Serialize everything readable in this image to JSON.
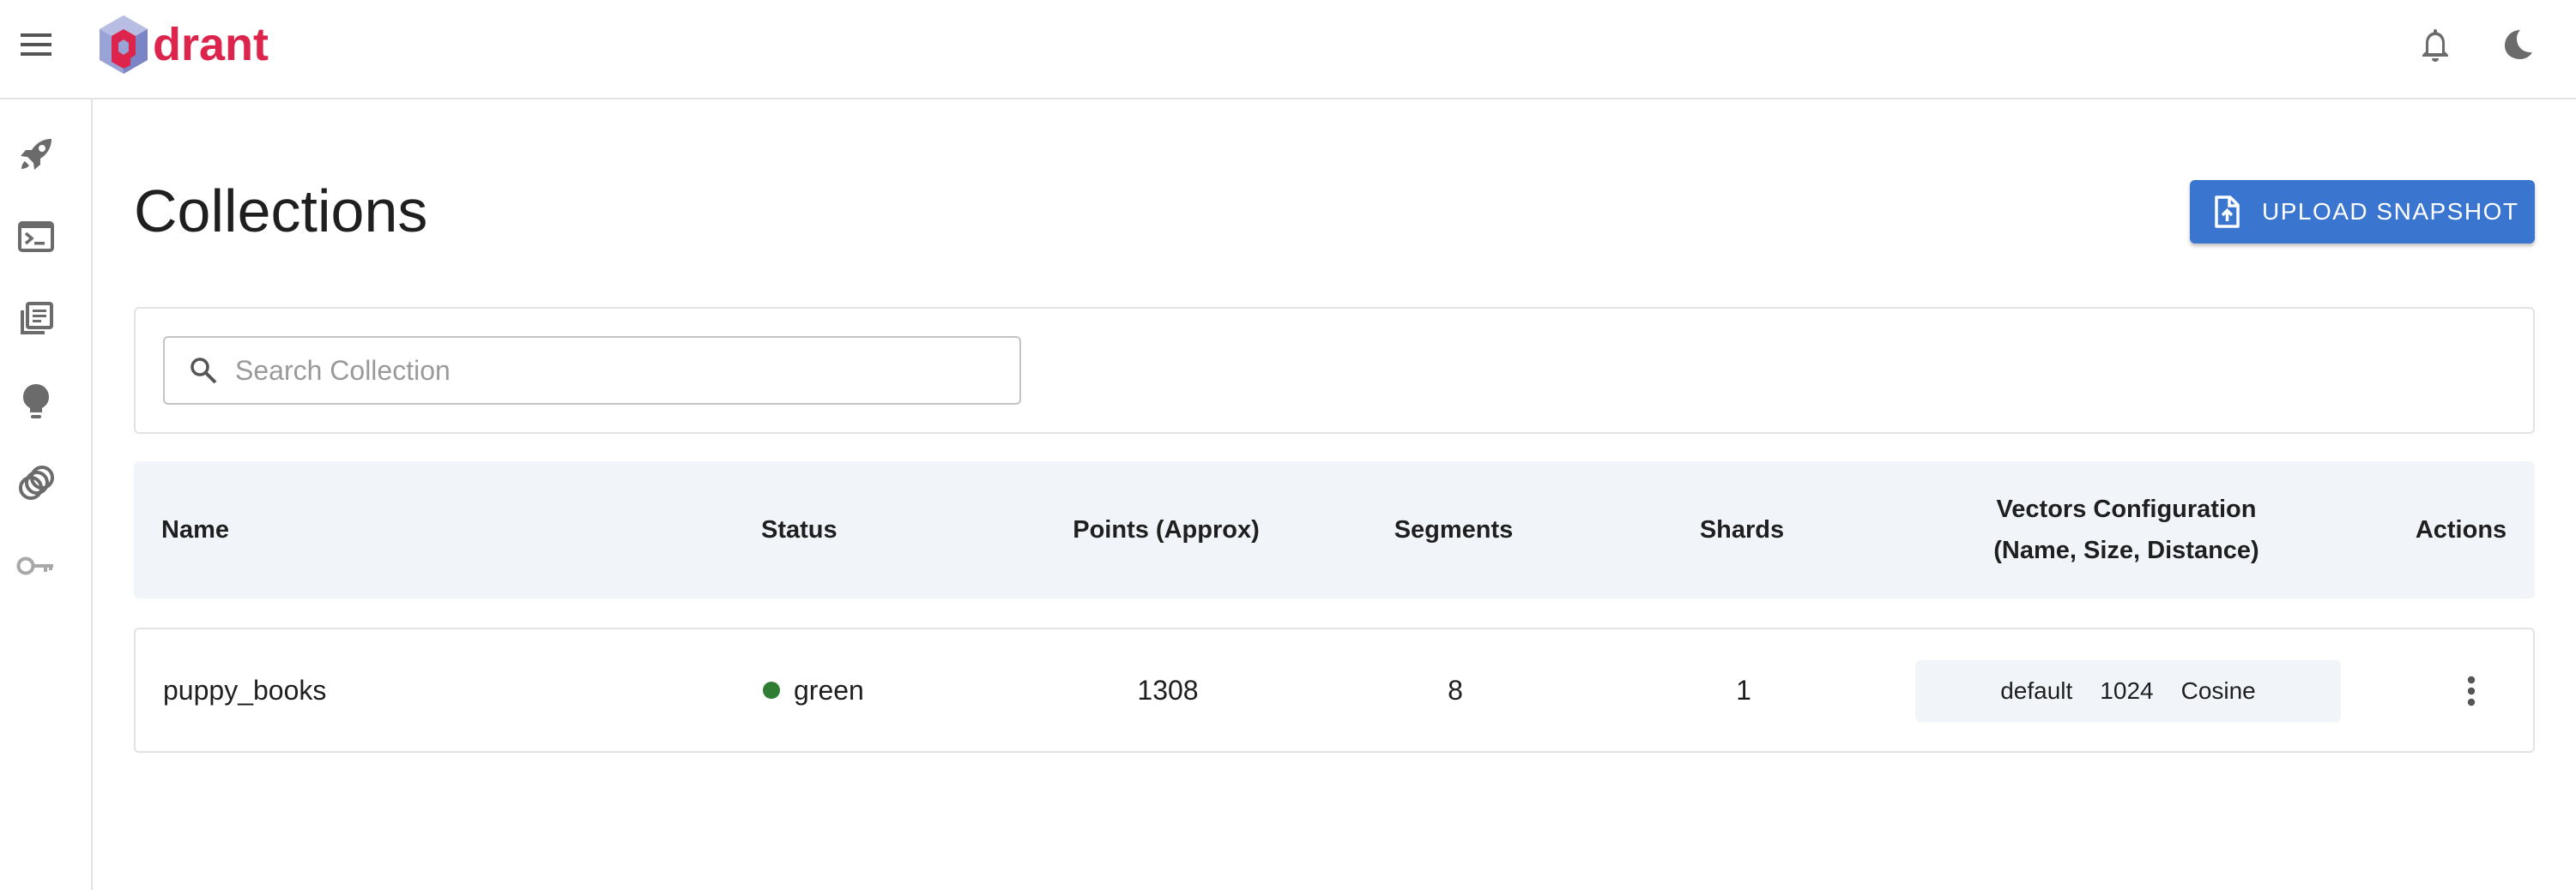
{
  "app": {
    "logo_text": "drant",
    "brand_color": "#dc244c",
    "accent_color": "#3a76d0"
  },
  "header": {
    "menu_icon": "menu-icon",
    "icons": [
      "bell-icon",
      "dark-mode-icon",
      "key-icon"
    ]
  },
  "sidebar": {
    "items": [
      {
        "name": "rocket-icon"
      },
      {
        "name": "console-icon"
      },
      {
        "name": "library-icon"
      },
      {
        "name": "lightbulb-icon"
      },
      {
        "name": "rings-icon"
      },
      {
        "name": "key-icon"
      }
    ]
  },
  "main": {
    "title": "Collections",
    "upload_label": "UPLOAD SNAPSHOT",
    "search_placeholder": "Search Collection"
  },
  "table": {
    "columns": {
      "name": "Name",
      "status": "Status",
      "points": "Points (Approx)",
      "segments": "Segments",
      "shards": "Shards",
      "vectors_line1": "Vectors Configuration",
      "vectors_line2": "(Name, Size, Distance)",
      "actions": "Actions"
    },
    "rows": [
      {
        "name": "puppy_books",
        "status": "green",
        "status_color": "#2e7d32",
        "points": "1308",
        "segments": "8",
        "shards": "1",
        "vector_name": "default",
        "vector_size": "1024",
        "vector_distance": "Cosine"
      }
    ]
  }
}
